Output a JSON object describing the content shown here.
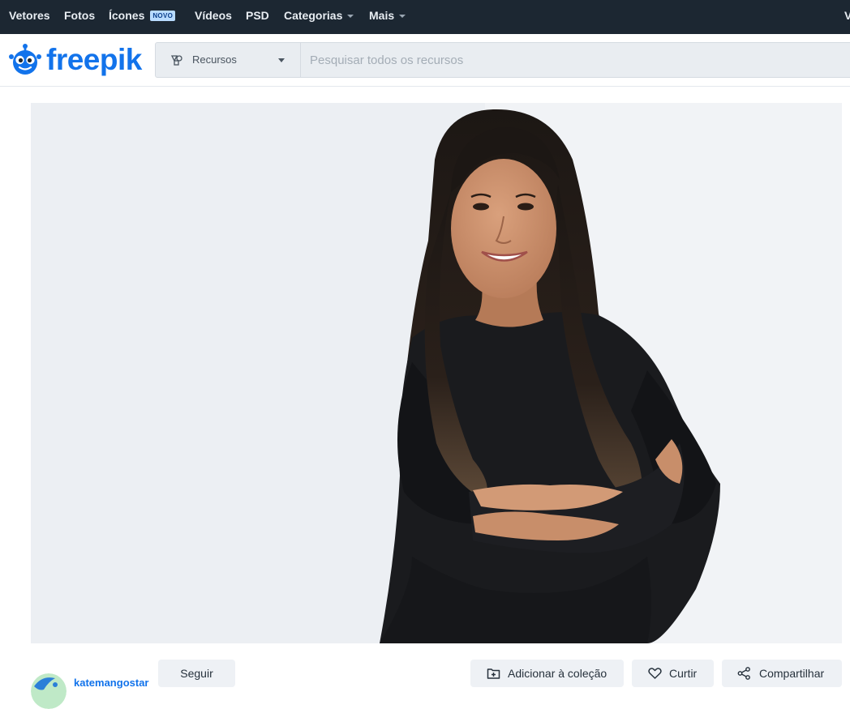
{
  "topnav": {
    "items": [
      {
        "label": "Vetores"
      },
      {
        "label": "Fotos"
      },
      {
        "label": "Ícones",
        "badge": "NOVO"
      },
      {
        "label": "Vídeos"
      },
      {
        "label": "PSD"
      },
      {
        "label": "Categorias"
      },
      {
        "label": "Mais"
      },
      {
        "label": "V"
      }
    ]
  },
  "header": {
    "logo_text": "freepik",
    "brand_color": "#1273eb",
    "resource_select": {
      "selected": "Recursos"
    },
    "search": {
      "placeholder": "Pesquisar todos os recursos",
      "value": ""
    }
  },
  "author": {
    "name": "katemangostar"
  },
  "actions": {
    "follow_label": "Seguir",
    "add_collection_label": "Adicionar à coleção",
    "like_label": "Curtir",
    "share_label": "Compartilhar"
  }
}
